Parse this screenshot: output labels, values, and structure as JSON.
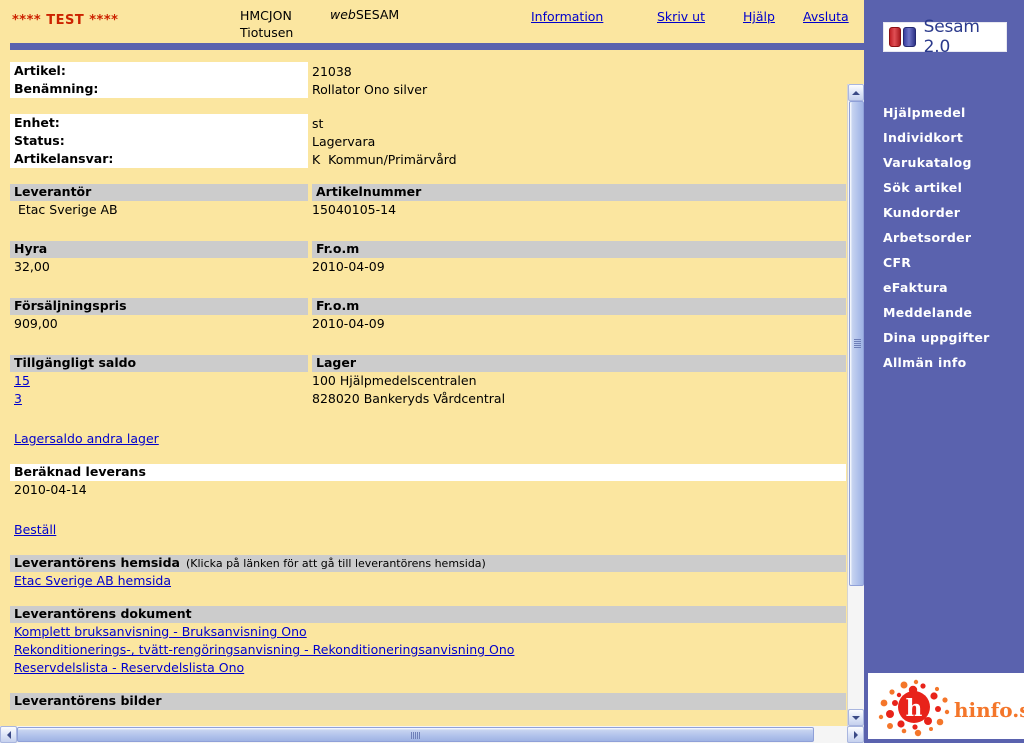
{
  "header": {
    "test_flag": "**** TEST ****",
    "user_id": "HMCJON",
    "user_name": "Tiotusen",
    "app_name_italic": "web",
    "app_name_rest": "SESAM",
    "links": [
      {
        "label": "Information"
      },
      {
        "label": "Skriv ut"
      },
      {
        "label": "Hjälp"
      },
      {
        "label": "Avsluta"
      }
    ]
  },
  "sidebar": {
    "logo_text": "Sesam 2.0",
    "bottom_logo_text": "hinfo.se",
    "accent_color": "#5A62AE",
    "items": [
      {
        "label": "Hjälpmedel"
      },
      {
        "label": "Individkort"
      },
      {
        "label": "Varukatalog"
      },
      {
        "label": "Sök artikel"
      },
      {
        "label": "Kundorder"
      },
      {
        "label": "Arbetsorder"
      },
      {
        "label": "CFR"
      },
      {
        "label": "eFaktura"
      },
      {
        "label": "Meddelande"
      },
      {
        "label": "Dina uppgifter"
      },
      {
        "label": "Allmän info"
      }
    ]
  },
  "article": {
    "fields_top": [
      {
        "label": "Artikel:",
        "value": "21038"
      },
      {
        "label": "Benämning:",
        "value": "Rollator Ono silver"
      }
    ],
    "fields_second": [
      {
        "label": "Enhet:",
        "value": "st"
      },
      {
        "label": "Status:",
        "value": "Lagervara"
      },
      {
        "label": "Artikelansvar:",
        "value": "K  Kommun/Primärvård"
      }
    ]
  },
  "supplier_section": {
    "head_a": "Leverantör",
    "head_b": "Artikelnummer",
    "rows": [
      {
        "a": " Etac Sverige AB",
        "b": "15040105-14"
      }
    ]
  },
  "rent_section": {
    "head_a": "Hyra",
    "head_b": "Fr.o.m",
    "rows": [
      {
        "a": "32,00",
        "b": "2010-04-09"
      }
    ]
  },
  "price_section": {
    "head_a": "Försäljningspris",
    "head_b": "Fr.o.m",
    "rows": [
      {
        "a": "909,00",
        "b": "2010-04-09"
      }
    ]
  },
  "stock_section": {
    "head_a": "Tillgängligt saldo",
    "head_b": "Lager",
    "rows": [
      {
        "a": "15",
        "b": "100 Hjälpmedelscentralen"
      },
      {
        "a": "3",
        "b": "828020 Bankeryds Vårdcentral"
      }
    ],
    "other_stock_link": "Lagersaldo andra lager"
  },
  "delivery_section": {
    "head": "Beräknad leverans",
    "date": "2010-04-14",
    "order_link": "Beställ"
  },
  "homepage_section": {
    "head": "Leverantörens hemsida",
    "head_note": "(Klicka på länken för att gå till leverantörens hemsida)",
    "link": "Etac Sverige AB hemsida"
  },
  "documents_section": {
    "head": "Leverantörens dokument",
    "links": [
      {
        "label": "Komplett bruksanvisning - Bruksanvisning Ono"
      },
      {
        "label": "Rekonditionerings-, tvätt-rengöringsanvisning - Rekonditioneringsanvisning Ono"
      },
      {
        "label": "Reservdelslista - Reservdelslista Ono"
      }
    ]
  },
  "images_section": {
    "head": "Leverantörens bilder"
  }
}
